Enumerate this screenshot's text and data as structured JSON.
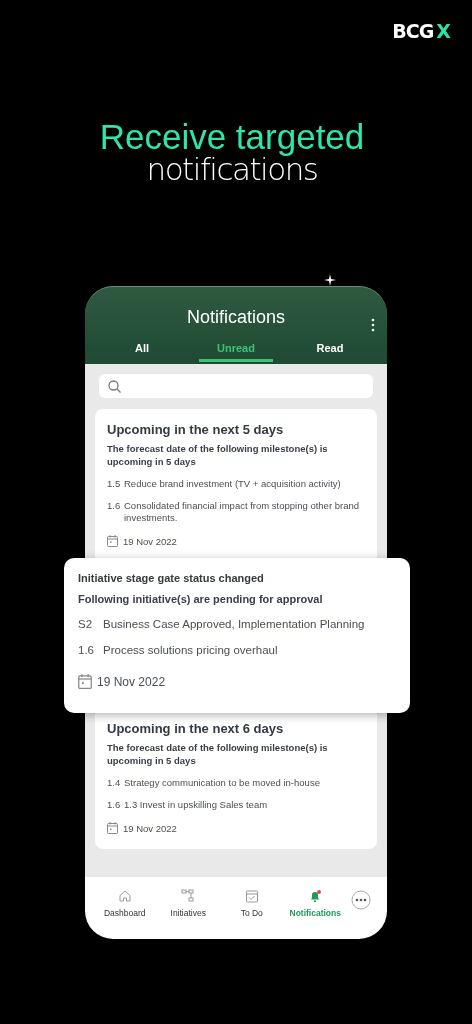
{
  "brand": {
    "name": "BCG",
    "mark": "X"
  },
  "headline": {
    "line_1": "Receive targeted",
    "line_2": "notifications"
  },
  "app": {
    "title": "Notifications",
    "tabs": [
      {
        "label": "All",
        "selected": false
      },
      {
        "label": "Unread",
        "selected": true
      },
      {
        "label": "Read",
        "selected": false
      }
    ],
    "notifications": [
      {
        "kind": "card",
        "title": "Upcoming in the next 5 days",
        "message": "The forecast date of the following milestone(s) is upcoming in 5 days",
        "items": [
          {
            "code": "1.5",
            "text": "Reduce brand investment (TV + acquisition activity)"
          },
          {
            "code": "1.6",
            "text": "Consolidated financial impact from stopping other brand investments."
          }
        ],
        "date": "19 Nov 2022"
      },
      {
        "kind": "popup",
        "title": "Initiative stage gate status changed",
        "message": "Following initiative(s) are pending for approval",
        "items": [
          {
            "code": "S2",
            "text": "Business Case Approved, Implementation Planning"
          },
          {
            "code": "1.6",
            "text": "Process solutions pricing overhaul"
          }
        ],
        "date": "19 Nov 2022"
      },
      {
        "kind": "card",
        "title": "Upcoming in the next 6 days",
        "message": "The forecast date of the following milestone(s) is upcoming in 5 days",
        "items": [
          {
            "code": "1.4",
            "text": "Strategy communication to be moved in-house"
          },
          {
            "code": "1.6",
            "text": "1.3 Invest in upskilling Sales team"
          }
        ],
        "date": "19 Nov 2022"
      }
    ],
    "nav": [
      {
        "label": "Dashboard",
        "selected": false,
        "alert": false
      },
      {
        "label": "Initiatives",
        "selected": false,
        "alert": false
      },
      {
        "label": "To Do",
        "selected": false,
        "alert": false
      },
      {
        "label": "Notifications",
        "selected": true,
        "alert": true
      }
    ]
  }
}
